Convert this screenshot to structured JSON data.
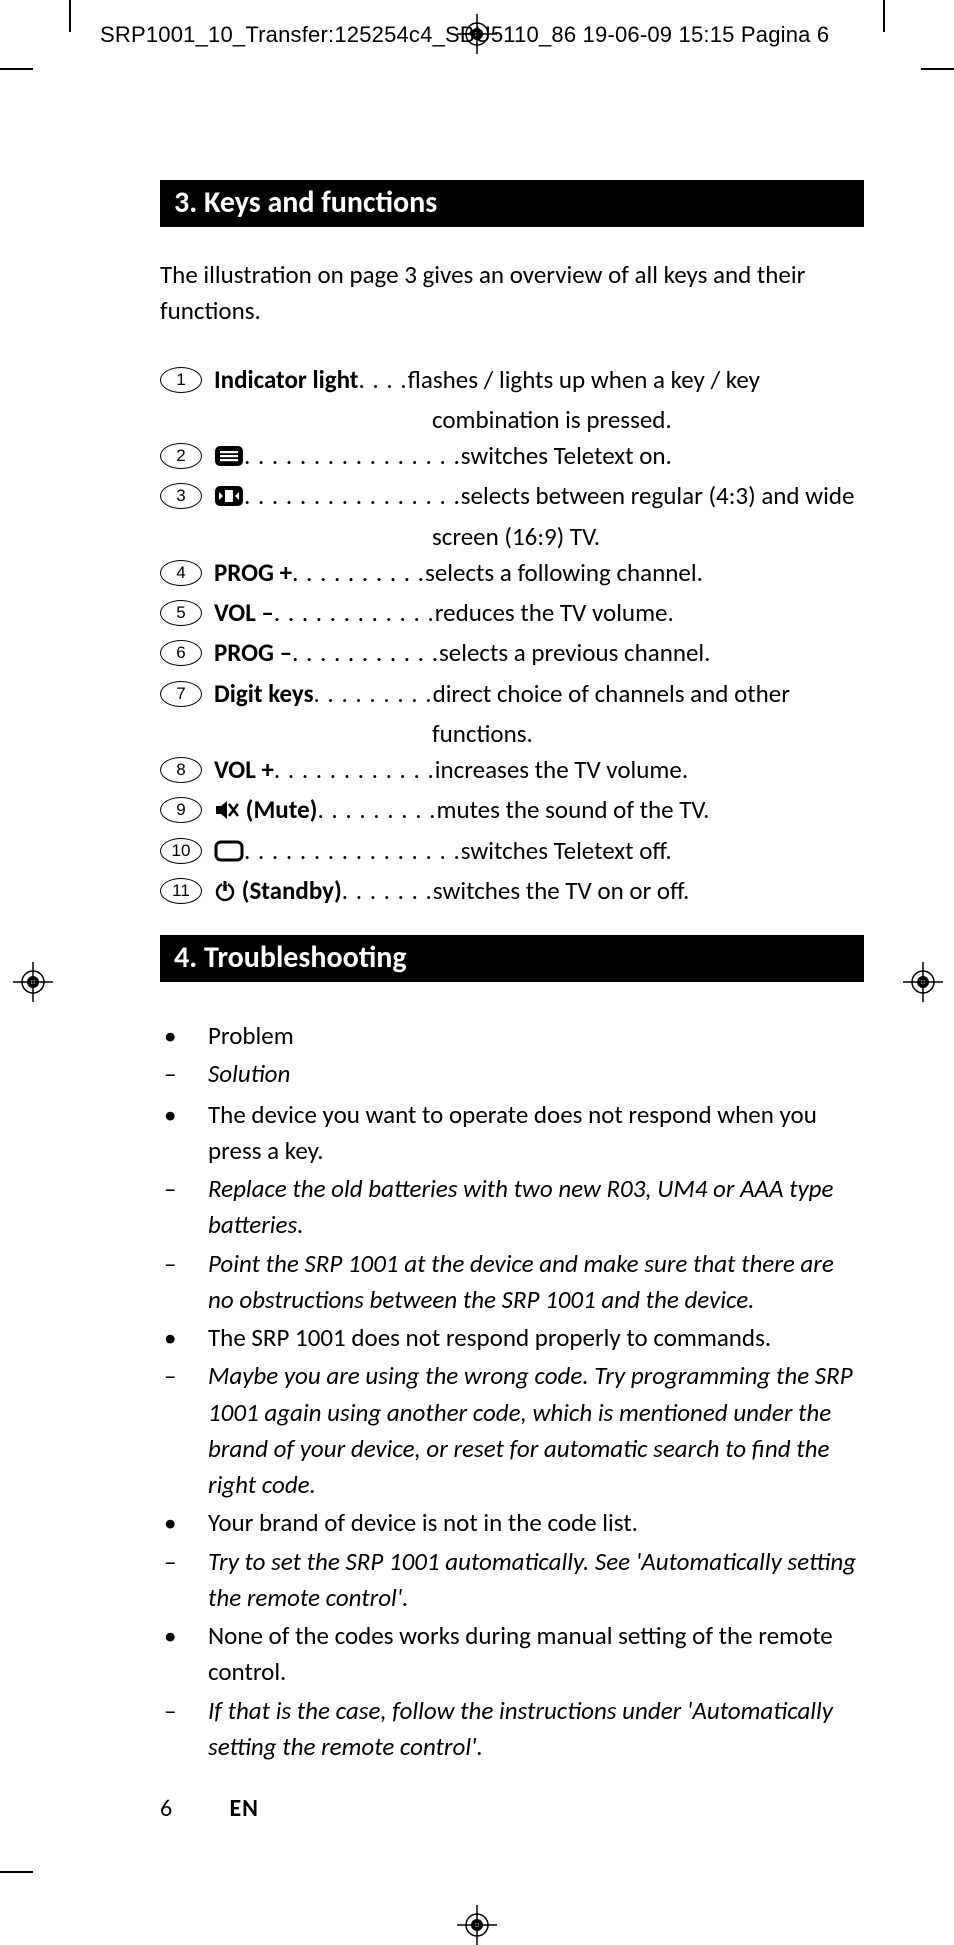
{
  "slug": "SRP1001_10_Transfer:125254c4_SBU5110_86  19-06-09  15:15  Pagina 6",
  "section3": {
    "title": "3. Keys and functions",
    "intro": "The illustration on page 3 gives an overview of all keys and their functions."
  },
  "keys": [
    {
      "n": "1",
      "label": "Indicator light",
      "bold": true,
      "icon": null,
      "dots": " . . . . ",
      "desc": "flashes / lights up when a key / key",
      "cont": "combination is pressed."
    },
    {
      "n": "2",
      "label": "",
      "bold": false,
      "icon": "teletext",
      "dots": " . . . . . . . . . . . . . . . . ",
      "desc": "switches Teletext on.",
      "cont": null
    },
    {
      "n": "3",
      "label": "",
      "bold": false,
      "icon": "wide",
      "dots": " . . . . . . . . . . . . . . . . ",
      "desc": "selects between regular (4:3) and wide",
      "cont": "screen (16:9) TV."
    },
    {
      "n": "4",
      "label": "PROG +",
      "bold": true,
      "icon": null,
      "dots": " . . . . . . . . . . ",
      "desc": "selects a following channel.",
      "cont": null
    },
    {
      "n": "5",
      "label": "VOL –",
      "bold": true,
      "icon": null,
      "dots": " . . . . . . . . . . . . ",
      "desc": "reduces the TV volume.",
      "cont": null
    },
    {
      "n": "6",
      "label": "PROG –",
      "bold": true,
      "icon": null,
      "dots": ". . . . . . . . . . . ",
      "desc": "selects a previous channel.",
      "cont": null
    },
    {
      "n": "7",
      "label": "Digit keys",
      "bold": true,
      "icon": null,
      "dots": " . . . . . . . . . ",
      "desc": "direct choice of channels and other",
      "cont": "functions."
    },
    {
      "n": "8",
      "label": "VOL +",
      "bold": true,
      "icon": null,
      "dots": " . . . . . . . . . . . . ",
      "desc": "increases the TV volume.",
      "cont": null
    },
    {
      "n": "9",
      "label": " (Mute)",
      "bold": true,
      "icon": "mute",
      "dots": " . . . . . . . . . ",
      "desc": "mutes the sound of the TV.",
      "cont": null
    },
    {
      "n": "10",
      "label": "",
      "bold": false,
      "icon": "tv-off",
      "dots": " . . . . . . . . . . . . . . . . ",
      "desc": "switches Teletext off.",
      "cont": null
    },
    {
      "n": "11",
      "label": " (Standby)",
      "bold": true,
      "icon": "power",
      "dots": " . . . . . . . ",
      "desc": "switches the TV on or off.",
      "cont": null
    }
  ],
  "section4": {
    "title": "4. Troubleshooting"
  },
  "ts": [
    {
      "mark": "•",
      "italic": false,
      "text": "Problem"
    },
    {
      "mark": "–",
      "italic": true,
      "text": "Solution"
    },
    {
      "mark": "",
      "italic": false,
      "text": " "
    },
    {
      "mark": "•",
      "italic": false,
      "text": "The device you want to operate does not respond when you press a key."
    },
    {
      "mark": "–",
      "italic": true,
      "text": "Replace the old batteries with two new R03, UM4 or AAA type batteries."
    },
    {
      "mark": "–",
      "italic": true,
      "text": "Point the SRP 1001 at the device and make sure that there are no obstructions between the SRP 1001 and the device."
    },
    {
      "mark": "•",
      "italic": false,
      "text": "The SRP 1001 does not respond properly to commands."
    },
    {
      "mark": "–",
      "italic": true,
      "text": "Maybe you are using the wrong code. Try programming the SRP 1001 again using another code, which is mentioned under the brand of your device, or reset for automatic search to find the right code."
    },
    {
      "mark": "•",
      "italic": false,
      "text": "Your brand of device is not in the code list."
    },
    {
      "mark": "–",
      "italic": true,
      "text": "Try to set the SRP 1001 automatically. See 'Automatically setting the remote control'."
    },
    {
      "mark": "•",
      "italic": false,
      "text": "None of the codes works during manual setting of the remote control."
    },
    {
      "mark": "–",
      "italic": true,
      "text": "If that is the case, follow the instructions under 'Automatically setting the remote control'."
    }
  ],
  "footer": {
    "page": "6",
    "lang": "EN"
  }
}
